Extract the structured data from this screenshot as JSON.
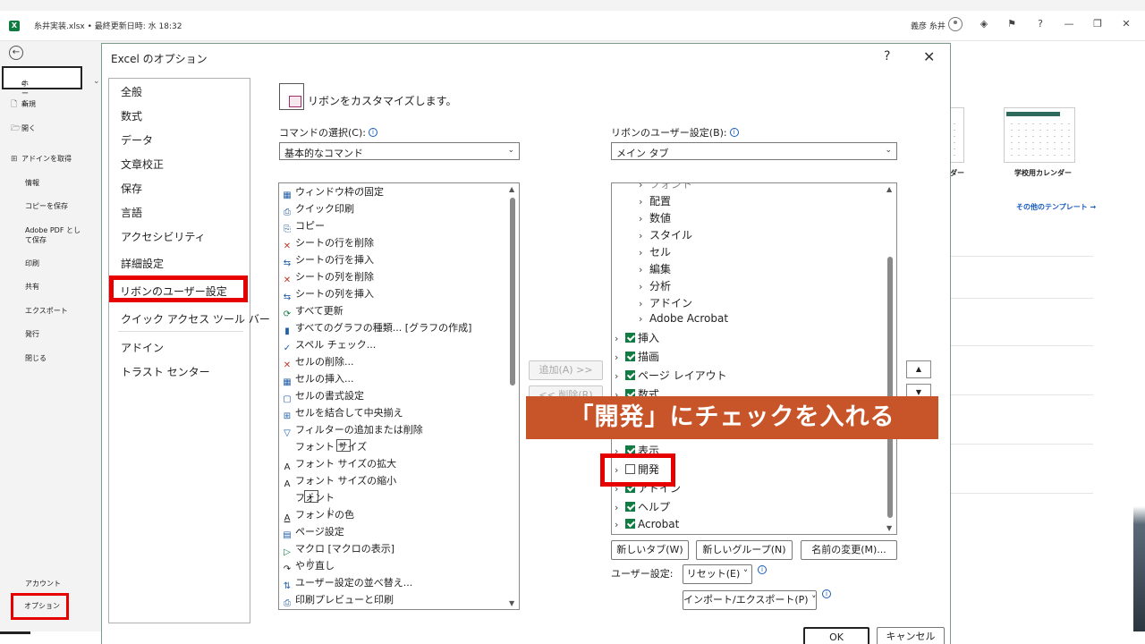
{
  "titlebar": {
    "app_icon": "X",
    "title": "糸井実装.xlsx • 最終更新日時: 水 18:32",
    "user": "義彦 糸井",
    "icons": [
      "diamond-icon",
      "feedback-icon",
      "help-icon",
      "minimize-icon",
      "restore-icon",
      "close-icon"
    ],
    "icon_glyphs": [
      "◈",
      "⚑",
      "?",
      "—",
      "❐",
      "✕"
    ]
  },
  "backstage": {
    "back": "←",
    "home": "ホーム",
    "new": "新規",
    "open": "開く",
    "get_addins": "アドインを取得",
    "info": "情報",
    "save_copy": "コピーを保存",
    "adobe_pdf_1": "Adobe PDF とし",
    "adobe_pdf_2": "て保存",
    "print": "印刷",
    "share": "共有",
    "export": "エクスポート",
    "publish": "発行",
    "close": "閉じる",
    "account": "アカウント",
    "options": "オプション",
    "collapse": "⌄",
    "tpl_label_1": "ンダー",
    "tpl_label_2": "学校用カレンダー",
    "more_templates": "その他のテンプレート →"
  },
  "dialog": {
    "title": "Excel のオプション",
    "help": "?",
    "close": "✕",
    "categories": [
      "全般",
      "数式",
      "データ",
      "文章校正",
      "保存",
      "言語",
      "アクセシビリティ",
      "詳細設定",
      "リボンのユーザー設定",
      "クイック アクセス ツール バー",
      "アドイン",
      "トラスト センター"
    ],
    "header": "リボンをカスタマイズします。",
    "commands_label": "コマンドの選択(C):",
    "commands_value": "基本的なコマンド",
    "ribbon_label": "リボンのユーザー設定(B):",
    "ribbon_value": "メイン タブ",
    "info": "i",
    "commands": [
      "ウィンドウ枠の固定",
      "クイック印刷",
      "コピー",
      "シートの行を削除",
      "シートの行を挿入",
      "シートの列を削除",
      "シートの列を挿入",
      "すべて更新",
      "すべてのグラフの種類... [グラフの作成]",
      "スペル チェック...",
      "セルの削除...",
      "セルの挿入...",
      "セルの書式設定",
      "セルを結合して中央揃え",
      "フィルターの追加または削除",
      "フォント サイズ",
      "フォント サイズの拡大",
      "フォント サイズの縮小",
      "フォント",
      "フォントの色",
      "ページ設定",
      "マクロ [マクロの表示]",
      "やり直し",
      "ユーザー設定の並べ替え...",
      "印刷プレビューと印刷"
    ],
    "command_icons": [
      "▦",
      "⎙",
      "⎘",
      "✕",
      "⇆",
      "✕",
      "⇆",
      "⟳",
      "▮",
      "✓",
      "✕",
      "▦",
      "▢",
      "⊞",
      "▽",
      " ",
      "A",
      "A",
      " ",
      "A",
      "▤",
      "▷",
      "↷",
      "⇅",
      "⎙"
    ],
    "tree_partial": "フォント",
    "tree_groups": [
      "配置",
      "数値",
      "スタイル",
      "セル",
      "編集",
      "分析",
      "アドイン",
      "Adobe Acrobat"
    ],
    "tree_tabs": [
      {
        "label": "挿入",
        "checked": true
      },
      {
        "label": "描画",
        "checked": true
      },
      {
        "label": "ページ レイアウト",
        "checked": true
      },
      {
        "label": "数式",
        "checked": true
      },
      {
        "label": "表示",
        "checked": true
      },
      {
        "label": "開発",
        "checked": false
      },
      {
        "label": "アドイン",
        "checked": true
      },
      {
        "label": "ヘルプ",
        "checked": true
      },
      {
        "label": "Acrobat",
        "checked": true
      }
    ],
    "add_button": "追加(A) >>",
    "remove_button": "<< 削除(R)",
    "move_up": "▲",
    "move_down": "▼",
    "new_tab": "新しいタブ(W)",
    "new_group": "新しいグループ(N)",
    "rename": "名前の変更(M)...",
    "user_settings_label": "ユーザー設定:",
    "reset": "リセット(E) ˅",
    "import_export": "インポート/エクスポート(P) ˅",
    "ok": "OK",
    "cancel": "キャンセル"
  },
  "annotation": {
    "banner": "「開発」にチェックを入れる",
    "highlight_color": "#e60000",
    "banner_color": "#c8552a"
  }
}
